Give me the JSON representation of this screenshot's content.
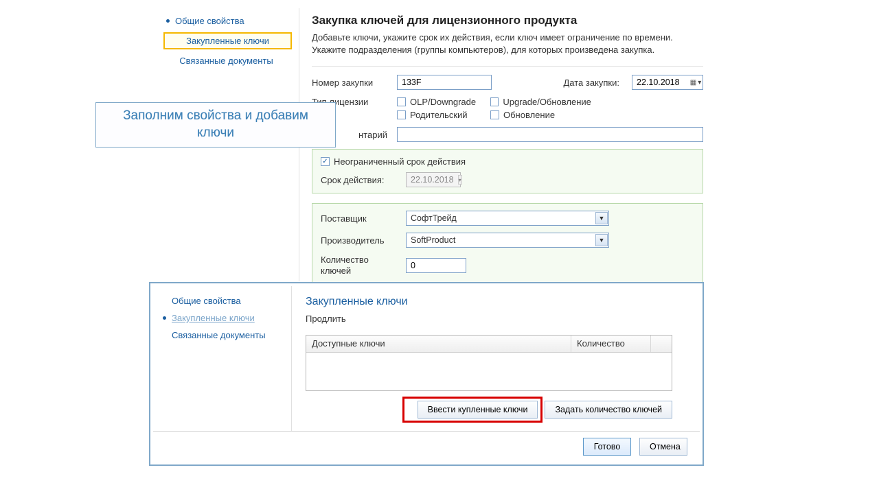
{
  "sidebar1": {
    "items": [
      {
        "label": "Общие свойства"
      },
      {
        "label": "Закупленные ключи"
      },
      {
        "label": "Связанные документы"
      }
    ]
  },
  "main1": {
    "title": "Закупка ключей для лицензионного продукта",
    "subtitle": "Добавьте ключи, укажите срок их действия, если ключ имеет ограничение по времени. Укажите подразделения (группы компьютеров), для которых произведена закупка.",
    "purchase_number_label": "Номер закупки",
    "purchase_number_value": "133F",
    "purchase_date_label": "Дата закупки:",
    "purchase_date_value": "22.10.2018",
    "license_type_label": "Тип лицензии",
    "license_types": {
      "olp": "OLP/Downgrade",
      "parent": "Родительский",
      "upgrade": "Upgrade/Обновление",
      "update": "Обновление"
    },
    "comment_label": "нтарий",
    "comment_value": "",
    "unlimited_label": "Неограниченный срок действия",
    "expiry_label": "Срок действия:",
    "expiry_value": "22.10.2018",
    "supplier_label": "Поставщик",
    "supplier_value": "СофтТрейд",
    "manufacturer_label": "Производитель",
    "manufacturer_value": "SoftProduct",
    "key_count_label": "Количество ключей",
    "key_count_value": "0"
  },
  "callout": {
    "text": "Заполним свойства и добавим ключи"
  },
  "win2": {
    "sidebar": {
      "items": [
        {
          "label": "Общие свойства"
        },
        {
          "label": "Закупленные ключи"
        },
        {
          "label": "Связанные документы"
        }
      ]
    },
    "title": "Закупленные ключи",
    "extend": "Продлить",
    "columns": {
      "available": "Доступные ключи",
      "quantity": "Количество"
    },
    "buttons": {
      "enter": "Ввести купленные ключи",
      "set_qty": "Задать количество ключей",
      "done": "Готово",
      "cancel": "Отмена"
    }
  }
}
